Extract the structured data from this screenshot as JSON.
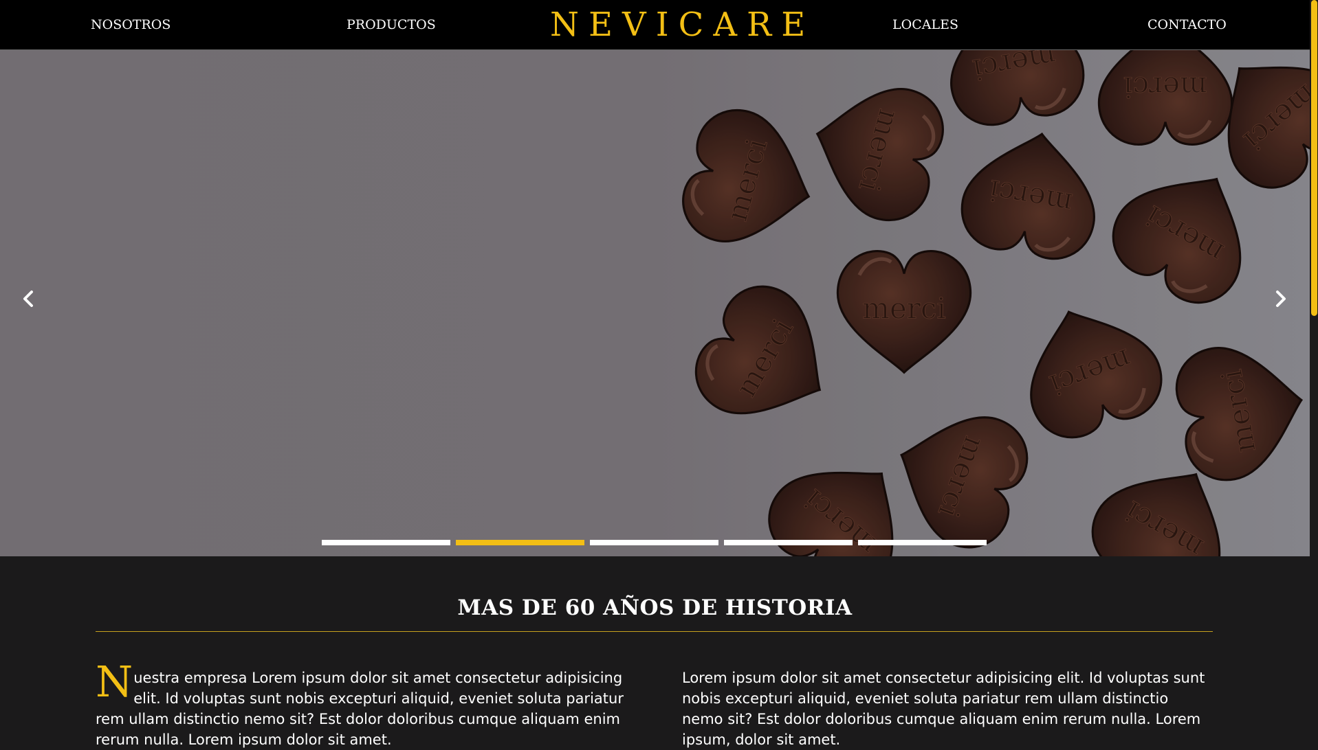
{
  "nav": {
    "nosotros": "NOSOTROS",
    "productos": "PRODUCTOS",
    "logo": "NEVICARE",
    "locales": "LOCALES",
    "contacto": "CONTACTO"
  },
  "hero": {
    "chocolate_label": "merci",
    "active_slide": 2,
    "slide_count": 5
  },
  "history": {
    "title": "MAS DE 60 AÑOS DE HISTORIA",
    "dropcap": "N",
    "left_text": "uestra empresa Lorem ipsum dolor sit amet consectetur adipisicing elit. Id voluptas sunt nobis excepturi aliquid, eveniet soluta pariatur rem ullam distinctio nemo sit? Est dolor doloribus cumque aliquam enim rerum nulla. Lorem ipsum dolor sit amet.",
    "right_text": "Lorem ipsum dolor sit amet consectetur adipisicing elit. Id voluptas sunt nobis excepturi aliquid, eveniet soluta pariatur rem ullam distinctio nemo sit? Est dolor doloribus cumque aliquam enim rerum nulla. Lorem ipsum, dolor sit amet."
  },
  "colors": {
    "accent": "#f3bf15",
    "nav_bg": "#000000",
    "section_bg": "#1b1a1b",
    "hero_bg": "#7c787c",
    "chocolate": "#3a2019"
  },
  "icons": {
    "prev": "chevron-left-icon",
    "next": "chevron-right-icon"
  }
}
